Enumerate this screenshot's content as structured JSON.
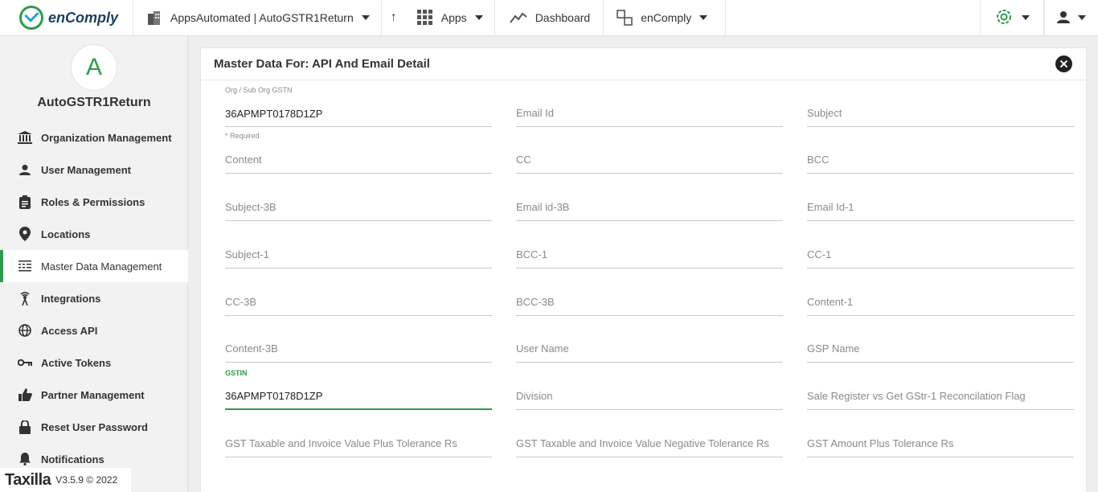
{
  "brand": {
    "name": "enComply"
  },
  "topbar": {
    "org_selector": "AppsAutomated | AutoGSTR1Return",
    "apps_label": "Apps",
    "dashboard_label": "Dashboard",
    "product_label": "enComply"
  },
  "sidebar": {
    "avatar_letter": "A",
    "org_name": "AutoGSTR1Return",
    "items": [
      {
        "label": "Organization Management",
        "icon": "bank-icon"
      },
      {
        "label": "User Management",
        "icon": "user-icon"
      },
      {
        "label": "Roles & Permissions",
        "icon": "clipboard-icon"
      },
      {
        "label": "Locations",
        "icon": "map-pin-icon"
      },
      {
        "label": "Master Data Management",
        "icon": "grid-list-icon",
        "active": true
      },
      {
        "label": "Integrations",
        "icon": "broadcast-icon"
      },
      {
        "label": "Access API",
        "icon": "globe-icon"
      },
      {
        "label": "Active Tokens",
        "icon": "key-icon"
      },
      {
        "label": "Partner Management",
        "icon": "thumbs-up-icon"
      },
      {
        "label": "Reset User Password",
        "icon": "lock-icon"
      },
      {
        "label": "Notifications",
        "icon": "bell-icon"
      }
    ],
    "footer_brand": "Taxilla",
    "footer_version": "V3.5.9 © 2022"
  },
  "panel": {
    "title": "Master Data For: API And Email Detail",
    "required_hint": "* Required",
    "fields": [
      {
        "label": "Org / Sub Org GSTN",
        "value": "36APMPT0178D1ZP"
      },
      {
        "label": "Email Id",
        "value": ""
      },
      {
        "label": "Subject",
        "value": ""
      },
      {
        "label": "Content",
        "value": ""
      },
      {
        "label": "CC",
        "value": ""
      },
      {
        "label": "BCC",
        "value": ""
      },
      {
        "label": "Subject-3B",
        "value": ""
      },
      {
        "label": "Email id-3B",
        "value": ""
      },
      {
        "label": "Email Id-1",
        "value": ""
      },
      {
        "label": "Subject-1",
        "value": ""
      },
      {
        "label": "BCC-1",
        "value": ""
      },
      {
        "label": "CC-1",
        "value": ""
      },
      {
        "label": "CC-3B",
        "value": ""
      },
      {
        "label": "BCC-3B",
        "value": ""
      },
      {
        "label": "Content-1",
        "value": ""
      },
      {
        "label": "Content-3B",
        "value": ""
      },
      {
        "label": "User Name",
        "value": ""
      },
      {
        "label": "GSP Name",
        "value": ""
      },
      {
        "label": "GSTIN",
        "value": "36APMPT0178D1ZP"
      },
      {
        "label": "Division",
        "value": ""
      },
      {
        "label": "Sale Register vs Get GStr-1 Reconcilation Flag",
        "value": ""
      },
      {
        "label": "GST Taxable and Invoice Value Plus Tolerance Rs",
        "value": ""
      },
      {
        "label": "GST Taxable and Invoice Value Negative Tolerance Rs",
        "value": ""
      },
      {
        "label": "GST Amount Plus Tolerance Rs",
        "value": ""
      }
    ]
  },
  "colors": {
    "accent": "#2e9b4b",
    "text": "#333333",
    "placeholder": "#8a8a8a"
  }
}
